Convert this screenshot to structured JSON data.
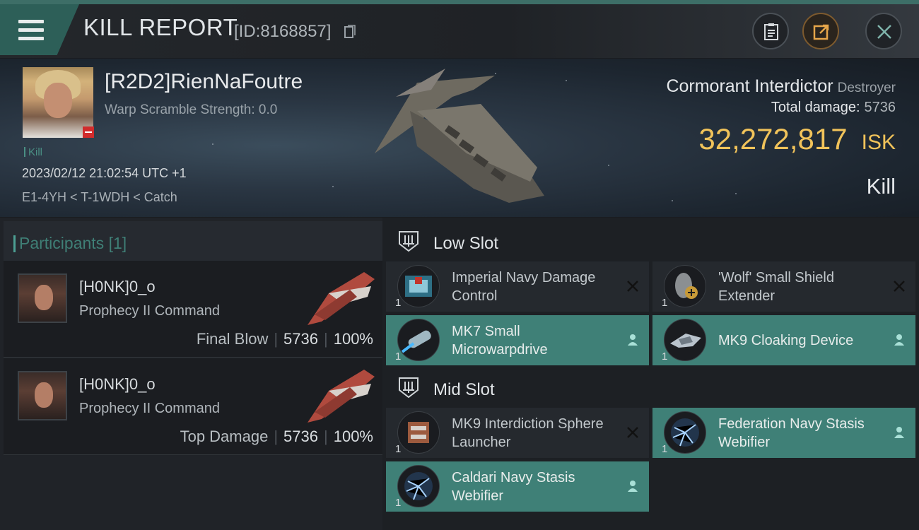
{
  "header": {
    "title": "KILL REPORT",
    "report_id": "[ID:8168857]"
  },
  "victim": {
    "name": "[R2D2]RienNaFoutre",
    "warp_scramble": "Warp Scramble Strength: 0.0",
    "tag": "Kill",
    "datetime": "2023/02/12 21:02:54 UTC +1",
    "location": "E1-4YH < T-1WDH < Catch",
    "ship_name": "Cormorant Interdictor",
    "ship_class": "Destroyer",
    "total_damage_label": "Total damage:",
    "total_damage": "5736",
    "isk_value": "32,272,817",
    "isk_unit": "ISK",
    "kill_type": "Kill"
  },
  "participants": {
    "heading": "Participants",
    "count": "[1]",
    "list": [
      {
        "name": "[H0NK]0_o",
        "ship": "Prophecy II Command",
        "role": "Final Blow",
        "damage": "5736",
        "percent": "100%"
      },
      {
        "name": "[H0NK]0_o",
        "ship": "Prophecy II Command",
        "role": "Top Damage",
        "damage": "5736",
        "percent": "100%"
      }
    ]
  },
  "slots": {
    "low": {
      "label": "Low Slot",
      "items": [
        {
          "name": "Imperial Navy Damage Control",
          "qty": "1",
          "status": "destroyed",
          "icon": "damage-control-icon"
        },
        {
          "name": "'Wolf' Small Shield Extender",
          "qty": "1",
          "status": "destroyed",
          "icon": "shield-extender-icon"
        },
        {
          "name": "MK7 Small Microwarpdrive",
          "qty": "1",
          "status": "dropped",
          "icon": "microwarpdrive-icon"
        },
        {
          "name": "MK9 Cloaking Device",
          "qty": "1",
          "status": "dropped",
          "icon": "cloaking-device-icon"
        }
      ]
    },
    "mid": {
      "label": "Mid Slot",
      "items": [
        {
          "name": "MK9 Interdiction Sphere Launcher",
          "qty": "1",
          "status": "destroyed",
          "icon": "sphere-launcher-icon"
        },
        {
          "name": "Federation Navy Stasis Webifier",
          "qty": "1",
          "status": "dropped",
          "icon": "stasis-webifier-icon"
        },
        {
          "name": "Caldari Navy Stasis Webifier",
          "qty": "1",
          "status": "dropped",
          "icon": "stasis-webifier-icon"
        }
      ]
    }
  },
  "colors": {
    "accent_teal": "#3f8077",
    "isk_gold": "#f1c35a",
    "kill_badge_red": "#d12c2c"
  }
}
